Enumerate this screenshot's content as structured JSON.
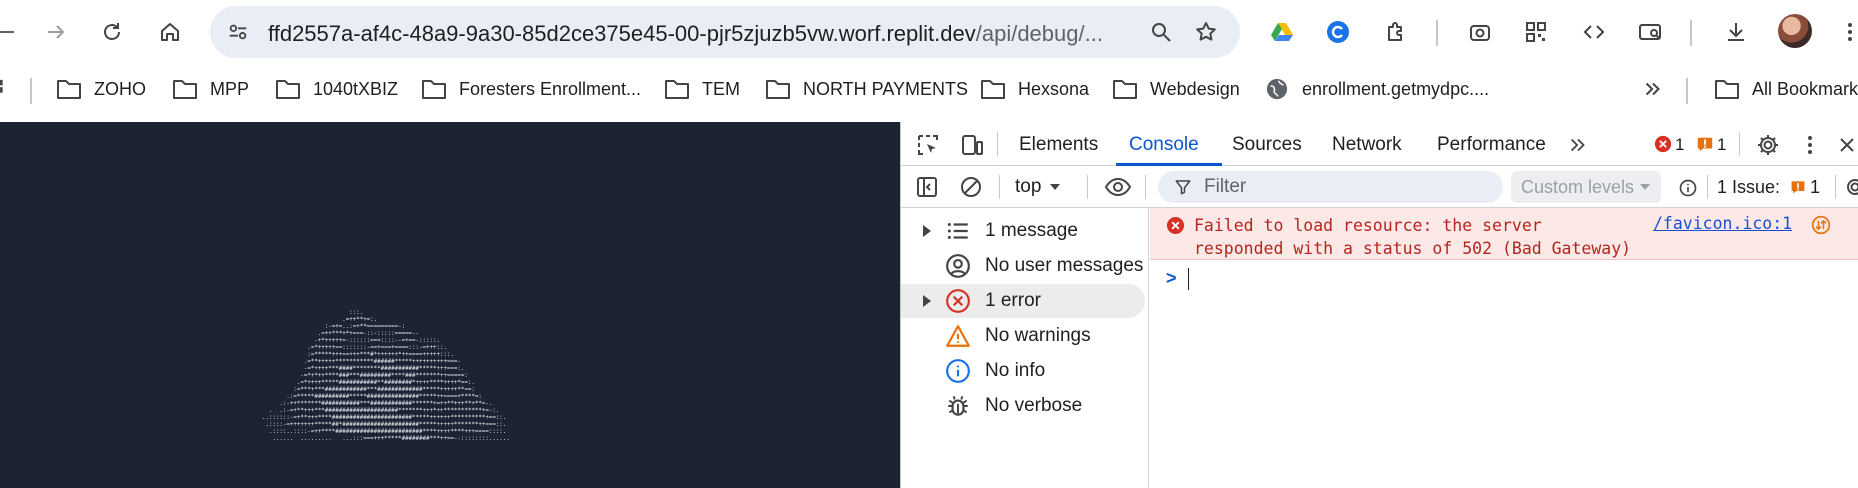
{
  "toolbar": {
    "url_host": "ffd2557a-af4c-48a9-9a30-85d2ce375e45-00-pjr5zjuzb5vw.worf.replit.dev",
    "url_path": "/api/debug/..."
  },
  "bookmarks": [
    {
      "label": "ZOHO",
      "icon": "folder-icon"
    },
    {
      "label": "MPP",
      "icon": "folder-icon"
    },
    {
      "label": "1040tXBIZ",
      "icon": "folder-icon"
    },
    {
      "label": "Foresters Enrollment...",
      "icon": "folder-icon"
    },
    {
      "label": "TEM",
      "icon": "folder-icon"
    },
    {
      "label": "NORTH PAYMENTS",
      "icon": "folder-icon"
    },
    {
      "label": "Hexsona",
      "icon": "folder-icon"
    },
    {
      "label": "Webdesign",
      "icon": "folder-icon"
    },
    {
      "label": "enrollment.getmydpc....",
      "icon": "globe-icon"
    },
    {
      "label": "All Bookmarks",
      "icon": "folder-icon"
    }
  ],
  "devtools": {
    "tabs": [
      "Elements",
      "Console",
      "Sources",
      "Network",
      "Performance"
    ],
    "active_tab": "Console",
    "error_count": "1",
    "warning_count": "1",
    "context": "top",
    "filter_placeholder": "Filter",
    "levels": "Custom levels",
    "issues_label": "1 Issue:",
    "issues_count": "1",
    "sidebar": [
      {
        "label": "1 message",
        "icon": "list-icon",
        "expandable": true
      },
      {
        "label": "No user messages",
        "icon": "user-icon",
        "expandable": false
      },
      {
        "label": "1 error",
        "icon": "error-icon",
        "expandable": true
      },
      {
        "label": "No warnings",
        "icon": "warning-icon",
        "expandable": false
      },
      {
        "label": "No info",
        "icon": "info-icon",
        "expandable": false
      },
      {
        "label": "No verbose",
        "icon": "bug-icon",
        "expandable": false
      }
    ],
    "console": {
      "error_line1": "Failed to load resource: the server",
      "error_line2": "responded with a status of 502 (Bad Gateway)",
      "error_source": "/favicon.ico:1",
      "prompt": ">"
    }
  },
  "colors": {
    "accent": "#0b57d0",
    "error": "#d93025",
    "warning": "#e8710a",
    "page_bg": "#1c2333"
  }
}
